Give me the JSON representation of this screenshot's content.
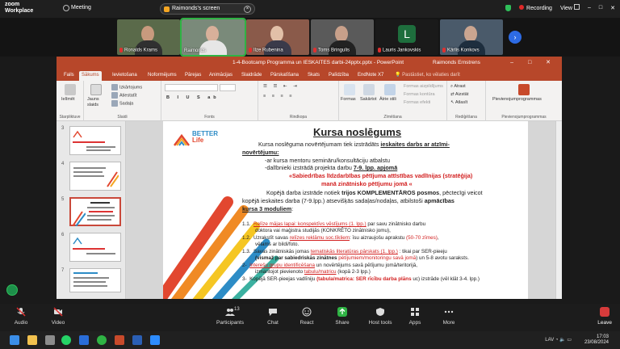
{
  "zoom_top": {
    "logo_line1": "zoom",
    "logo_line2": "Workplace",
    "meeting": "Meeting",
    "shared_screen": "Raimonds's screen",
    "recording": "Recording",
    "view": "View"
  },
  "participants": [
    {
      "name": "Ronalds Krams"
    },
    {
      "name": "Raimonds"
    },
    {
      "name": "Ilze Rubenina"
    },
    {
      "name": "Toms Bringulis"
    },
    {
      "name": "Lauris Jankovskis",
      "initial": "L"
    },
    {
      "name": "Kārlis Konkovs"
    }
  ],
  "ppt": {
    "title": "1-4-Bootcamp Programma un IESKAITES darbi-24pptx.pptx - PowerPoint",
    "user": "Raimonds Ernstrens",
    "tabs": [
      "Fails",
      "Sākums",
      "Ievietošana",
      "Noformējums",
      "Pārejas",
      "Animācijas",
      "Slaidrāde",
      "Pārskatīšana",
      "Skats",
      "Palīdzība",
      "EndNote X7"
    ],
    "tell_me": "Pastāstiet, ko vēlaties darīt",
    "ribbon": {
      "paste": "Ielīmēt",
      "clipboard": "Starpliktuve",
      "new_slide": "Jauns slaids",
      "layout": "Izkārtojums",
      "reset": "Atiestatīt",
      "section": "Sadaļa",
      "slides": "Slaidi",
      "font": "Fonts",
      "paragraph": "Rindkopa",
      "shapes": "Formas",
      "arrange": "Sakārtot",
      "quick_styles": "Ātrie stili",
      "shape_fill": "Formas aizpildījums",
      "shape_outline": "Formas kontūra",
      "shape_effects": "Formas efekti",
      "drawing": "Zīmēšana",
      "find": "Atrast",
      "replace": "Aizstāt",
      "select": "Atlasīt",
      "editing": "Rediģēšana",
      "addins": "Pievienojumprogrammas",
      "addins_group": "Pievienojumprogrammas"
    },
    "thumb_numbers": [
      "3",
      "4",
      "5",
      "6",
      "7"
    ]
  },
  "slide": {
    "brand_line1": "BETTER",
    "brand_line2": "Life",
    "title": "Kursa noslēgums",
    "p1a": "Kursa noslēguma novērtējumam tiek izstrādāts ",
    "p1b": "ieskaites darbs ar atzīmi-",
    "p1c": "novērtējumu:",
    "b1": "-ar kursa mentoru semināru/konsultāciju atbalstu",
    "b2a": "-dalībnieki izstrādā projekta darbu ",
    "b2b": "7-9. lpp. apjomā",
    "q1": "«Sabiedrības līdzdarbības pētījuma attīstības vadlīnijas (stratēģija)",
    "q2": "manā zinātnisko pētījumu jomā «",
    "p2a": "Kopējā darba izstrāde notiek ",
    "p2b": "trijos KOMPLEMENTĀROS posmos",
    "p2c": ", pēctecīgi veicot",
    "p3": "kopējā ieskaites darba (7-9.lpp.) atsevišķās sadaļas/nodaļas, atbilstoši ",
    "p3b": "apmācības",
    "p4": "kursa 3 moduliem",
    "p4c": ":",
    "i11n": "1.1.",
    "i11a": "Relīze mājas lapai: konspektīvs vēstījums (1. lpp.)",
    "i11b": " par savu zinātnisko darbu",
    "i11c": "doktora vai maģistra studijās (KONKRĒTO zinātnisko jomu),",
    "i12n": "1.2.",
    "i12a": "Uzrakstīt savas ",
    "i12b": "relīzes reklāmu soc.tīkliem",
    "i12c": ": īsu aizraujošu aprakstu ",
    "i12d": "(50-70 zīmes)",
    "i12e": ",",
    "i12f": "vēlams ar bildi/foto.",
    "i13n": "1.3.",
    "i13a": "Savas zinātniskās jomas ",
    "i13b": "tematiskās literatūras pārskats (1. lpp.)",
    "i13c": " : tikai par SER-pieeju",
    "i13d": "(vismaž par sabiedriskās zinātnes ",
    "i13e": "pētījumiem/monitoringu savā jomā",
    "i13f": ") un 5-8 avotu saraksts.",
    "i2n": "2-",
    "i2a": "Interešu grupu identificēšana",
    "i2b": " un novērtējums savā pētījumu jomā/teritorijā,",
    "i2c": "izmantojot pievienoto ",
    "i2d": "tabulu/matricu",
    "i2e": " (kopā 2-3 lpp.)",
    "i3n": "3-",
    "i3a": "Kopējā SER-pieejas vadlīniju ",
    "i3b": "(tabula/matrica: SER rīcību darba plāns",
    "i3c": " uc) izstrāde (vēl klāt 3-4. lpp.)"
  },
  "zoom_bottom": {
    "audio": "Audio",
    "video": "Video",
    "participants": "Participants",
    "participants_count": "13",
    "chat": "Chat",
    "react": "React",
    "share": "Share",
    "host_tools": "Host tools",
    "apps": "Apps",
    "more": "More",
    "leave": "Leave"
  },
  "taskbar": {
    "lang": "LAV",
    "time": "17:03",
    "date": "23/08/2024"
  },
  "colors": {
    "ppt_accent": "#b7472a",
    "zoom_green": "#2fb344",
    "slide_red": "#d21f1f"
  }
}
